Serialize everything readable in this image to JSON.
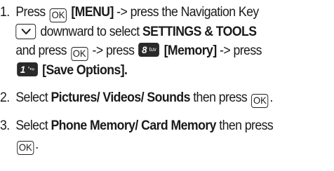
{
  "steps": [
    {
      "number": "1.",
      "t1": "Press",
      "menu_label": "[MENU]",
      "t2": "-> press the Navigation Key",
      "t3": "downward to select",
      "settings_label": "SETTINGS & TOOLS",
      "t4": "and press",
      "t5": "-> press",
      "memory_label": "[Memory]",
      "t6": "-> press",
      "save_label": "[Save Options]."
    },
    {
      "number": "2.",
      "t1": "Select",
      "bold": "Pictures/ Videos/ Sounds",
      "t2": "then press",
      "t3": "."
    },
    {
      "number": "3.",
      "t1": "Select",
      "bold": "Phone Memory/ Card Memory",
      "t2": "then press",
      "t3": "."
    }
  ],
  "keys": {
    "ok": "OK",
    "eight_digit": "8",
    "eight_letters": "tuv",
    "one_digit": "1",
    "one_symbol": "°•»"
  },
  "icons": {
    "nav_down": "chevron-down-icon"
  }
}
